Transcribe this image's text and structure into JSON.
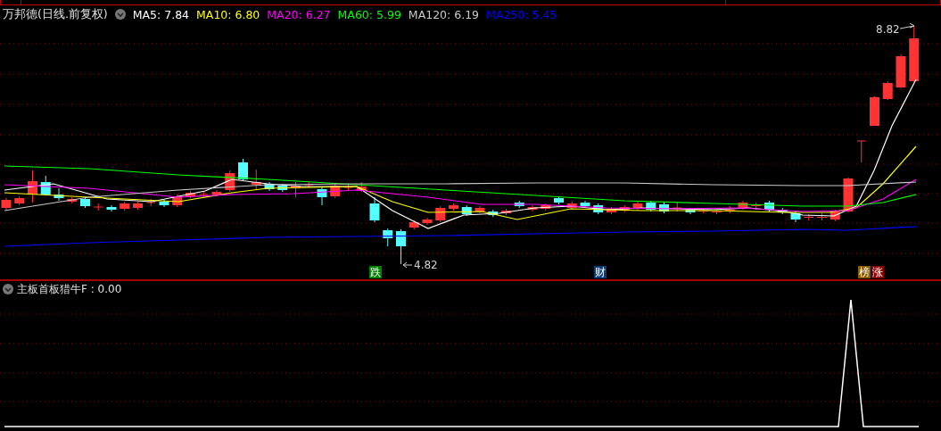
{
  "header": {
    "title": "万邦德(日线.前复权)",
    "moving_averages": [
      {
        "label": "MA5: 7.84",
        "color": "#ffffff"
      },
      {
        "label": "MA10: 6.80",
        "color": "#ffff00"
      },
      {
        "label": "MA20: 6.27",
        "color": "#ff00ff"
      },
      {
        "label": "MA60: 5.99",
        "color": "#00ff00"
      },
      {
        "label": "MA120: 6.19",
        "color": "#c8c8c8"
      },
      {
        "label": "MA250: 5.45",
        "color": "#0000ff"
      }
    ]
  },
  "price_chart": {
    "high_label": "8.82",
    "low_label": "4.82",
    "markers": [
      {
        "text": "跌",
        "color": "#008000"
      },
      {
        "text": "财",
        "color": "#0a3d78"
      },
      {
        "text": "榜",
        "color": "#8b5a00"
      },
      {
        "text": "涨",
        "color": "#8b0000"
      }
    ]
  },
  "indicator": {
    "label": "主板首板猎牛F : 0.00"
  }
}
